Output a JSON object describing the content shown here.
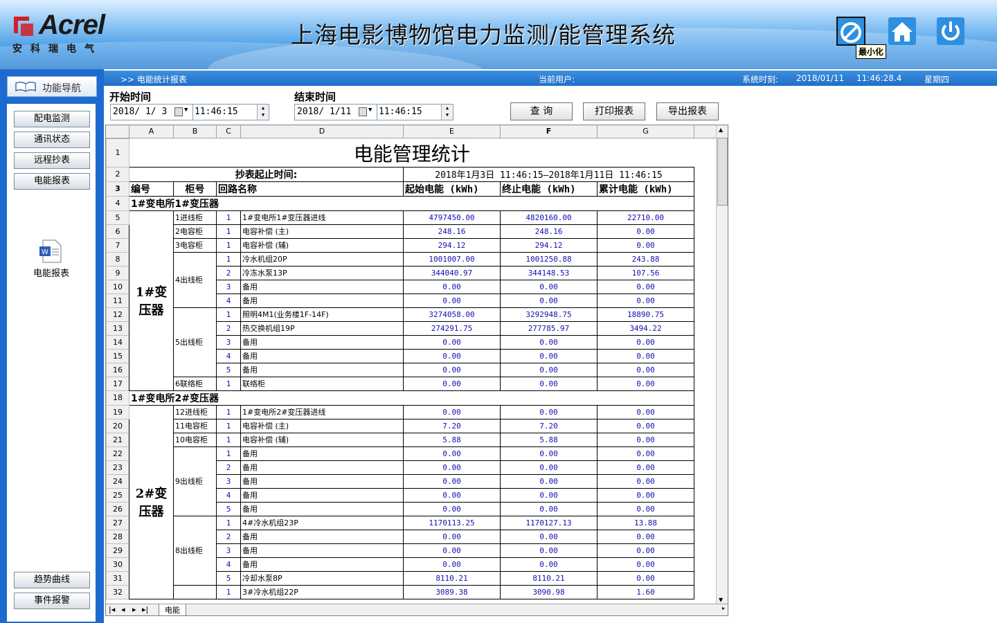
{
  "header": {
    "logo_text": "Acrel",
    "logo_cn": "安科瑞电气",
    "title": "上海电影博物馆电力监测/能管理系统",
    "tooltip": "最小化",
    "buttons": [
      "minimize-icon",
      "home-icon",
      "power-icon"
    ]
  },
  "navbar": {
    "breadcrumb": ">>  电能统计报表",
    "user_label": "当前用户:",
    "time_label": "系统时刻:",
    "date": "2018/01/11",
    "time": "11:46:28.4",
    "weekday": "星期四"
  },
  "sidebar": {
    "nav_title": "功能导航",
    "items": [
      "配电监测",
      "通讯状态",
      "远程抄表",
      "电能报表"
    ],
    "doc_label": "电能报表",
    "bottom_items": [
      "趋势曲线",
      "事件报警"
    ]
  },
  "toolbar": {
    "start_label": "开始时间",
    "start_date": "2018/ 1/ 3",
    "start_time": "11:46:15",
    "end_label": "结束时间",
    "end_date": "2018/ 1/11",
    "end_time": "11:46:15",
    "query": "查 询",
    "print": "打印报表",
    "export": "导出报表"
  },
  "sheet": {
    "columns": [
      "A",
      "B",
      "C",
      "D",
      "E",
      "F",
      "G"
    ],
    "title": "电能管理统计",
    "period_label": "抄表起止时间:",
    "period_value": "2018年1月3日  11:46:15—2018年1月11日  11:46:15",
    "headers": [
      "编号",
      "柜号",
      "回路名称",
      "起始电能 (kWh)",
      "终止电能 (kWh)",
      "累计电能 (kWh)"
    ],
    "section1": "1#变电所1#变压器",
    "section2": "1#变电所2#变压器",
    "group1": "1#变压器",
    "group2": "2#变压器",
    "tab": "电能",
    "rows": [
      {
        "n": "5",
        "cab": "1进线柜",
        "loop": "1",
        "name": "1#变电所1#变压器进线",
        "e": "4797450.00",
        "f": "4820160.00",
        "g": "22710.00"
      },
      {
        "n": "6",
        "cab": "2电容柜",
        "loop": "1",
        "name": "电容补偿 (主)",
        "e": "248.16",
        "f": "248.16",
        "g": "0.00"
      },
      {
        "n": "7",
        "cab": "3电容柜",
        "loop": "1",
        "name": "电容补偿 (辅)",
        "e": "294.12",
        "f": "294.12",
        "g": "0.00"
      },
      {
        "n": "8",
        "cab": "",
        "loop": "1",
        "name": "冷水机组20P",
        "e": "1001007.00",
        "f": "1001250.88",
        "g": "243.88"
      },
      {
        "n": "9",
        "cab": "4出线柜",
        "loop": "2",
        "name": "冷冻水泵13P",
        "e": "344040.97",
        "f": "344148.53",
        "g": "107.56"
      },
      {
        "n": "10",
        "cab": "",
        "loop": "3",
        "name": "备用",
        "e": "0.00",
        "f": "0.00",
        "g": "0.00"
      },
      {
        "n": "11",
        "cab": "",
        "loop": "4",
        "name": "备用",
        "e": "0.00",
        "f": "0.00",
        "g": "0.00"
      },
      {
        "n": "12",
        "cab": "",
        "loop": "1",
        "name": "照明4M1(业务楼1F-14F)",
        "e": "3274058.00",
        "f": "3292948.75",
        "g": "18890.75"
      },
      {
        "n": "13",
        "cab": "",
        "loop": "2",
        "name": "热交换机组19P",
        "e": "274291.75",
        "f": "277785.97",
        "g": "3494.22"
      },
      {
        "n": "14",
        "cab": "5出线柜",
        "loop": "3",
        "name": "备用",
        "e": "0.00",
        "f": "0.00",
        "g": "0.00"
      },
      {
        "n": "15",
        "cab": "",
        "loop": "4",
        "name": "备用",
        "e": "0.00",
        "f": "0.00",
        "g": "0.00"
      },
      {
        "n": "16",
        "cab": "",
        "loop": "5",
        "name": "备用",
        "e": "0.00",
        "f": "0.00",
        "g": "0.00"
      },
      {
        "n": "17",
        "cab": "6联络柜",
        "loop": "1",
        "name": "联络柜",
        "e": "0.00",
        "f": "0.00",
        "g": "0.00"
      },
      {
        "n": "19",
        "cab": "12进线柜",
        "loop": "1",
        "name": "1#变电所2#变压器进线",
        "e": "0.00",
        "f": "0.00",
        "g": "0.00"
      },
      {
        "n": "20",
        "cab": "11电容柜",
        "loop": "1",
        "name": "电容补偿 (主)",
        "e": "7.20",
        "f": "7.20",
        "g": "0.00"
      },
      {
        "n": "21",
        "cab": "10电容柜",
        "loop": "1",
        "name": "电容补偿 (辅)",
        "e": "5.88",
        "f": "5.88",
        "g": "0.00"
      },
      {
        "n": "22",
        "cab": "",
        "loop": "1",
        "name": "备用",
        "e": "0.00",
        "f": "0.00",
        "g": "0.00"
      },
      {
        "n": "23",
        "cab": "",
        "loop": "2",
        "name": "备用",
        "e": "0.00",
        "f": "0.00",
        "g": "0.00"
      },
      {
        "n": "24",
        "cab": "9出线柜",
        "loop": "3",
        "name": "备用",
        "e": "0.00",
        "f": "0.00",
        "g": "0.00"
      },
      {
        "n": "25",
        "cab": "",
        "loop": "4",
        "name": "备用",
        "e": "0.00",
        "f": "0.00",
        "g": "0.00"
      },
      {
        "n": "26",
        "cab": "",
        "loop": "5",
        "name": "备用",
        "e": "0.00",
        "f": "0.00",
        "g": "0.00"
      },
      {
        "n": "27",
        "cab": "",
        "loop": "1",
        "name": "4#冷水机组23P",
        "e": "1170113.25",
        "f": "1170127.13",
        "g": "13.88"
      },
      {
        "n": "28",
        "cab": "",
        "loop": "2",
        "name": "备用",
        "e": "0.00",
        "f": "0.00",
        "g": "0.00"
      },
      {
        "n": "29",
        "cab": "8出线柜",
        "loop": "3",
        "name": "备用",
        "e": "0.00",
        "f": "0.00",
        "g": "0.00"
      },
      {
        "n": "30",
        "cab": "",
        "loop": "4",
        "name": "备用",
        "e": "0.00",
        "f": "0.00",
        "g": "0.00"
      },
      {
        "n": "31",
        "cab": "",
        "loop": "5",
        "name": "冷却水泵8P",
        "e": "8110.21",
        "f": "8110.21",
        "g": "0.00"
      },
      {
        "n": "32",
        "cab": "",
        "loop": "1",
        "name": "3#冷水机组22P",
        "e": "3089.38",
        "f": "3090.98",
        "g": "1.60"
      }
    ]
  }
}
